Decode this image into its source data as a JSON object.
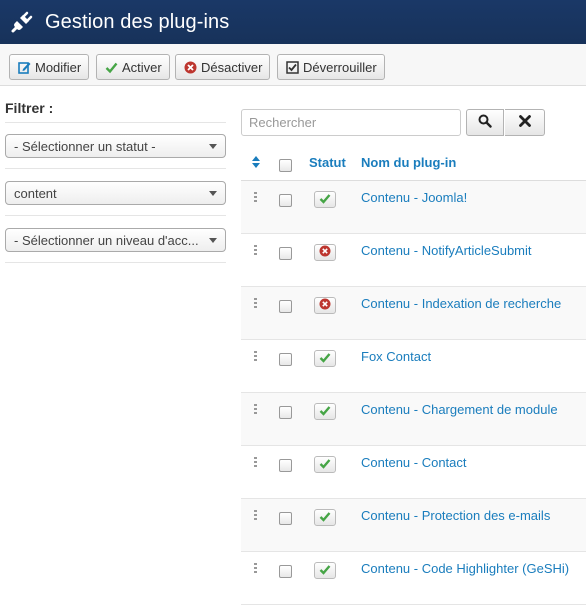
{
  "header": {
    "title": "Gestion des plug-ins",
    "background": "#17325a"
  },
  "toolbar": {
    "edit_label": "Modifier",
    "enable_label": "Activer",
    "disable_label": "Désactiver",
    "unlock_label": "Déverrouiller"
  },
  "sidebar": {
    "filter_title": "Filtrer :",
    "status_select": "- Sélectionner un statut -",
    "type_select": "content",
    "access_select": "- Sélectionner un niveau d'acc..."
  },
  "search": {
    "placeholder": "Rechercher"
  },
  "table": {
    "col_status": "Statut",
    "col_name": "Nom du plug-in",
    "rows": [
      {
        "name": "Contenu - Joomla!",
        "enabled": true
      },
      {
        "name": "Contenu - NotifyArticleSubmit",
        "enabled": false
      },
      {
        "name": "Contenu - Indexation de recherche",
        "enabled": false
      },
      {
        "name": "Fox Contact",
        "enabled": true
      },
      {
        "name": "Contenu - Chargement de module",
        "enabled": true
      },
      {
        "name": "Contenu - Contact",
        "enabled": true
      },
      {
        "name": "Contenu - Protection des e-mails",
        "enabled": true
      },
      {
        "name": "Contenu - Code Highlighter (GeSHi)",
        "enabled": true
      }
    ]
  },
  "colors": {
    "link": "#1a7dbd",
    "enabled": "#46a546",
    "disabled": "#bd362f"
  }
}
